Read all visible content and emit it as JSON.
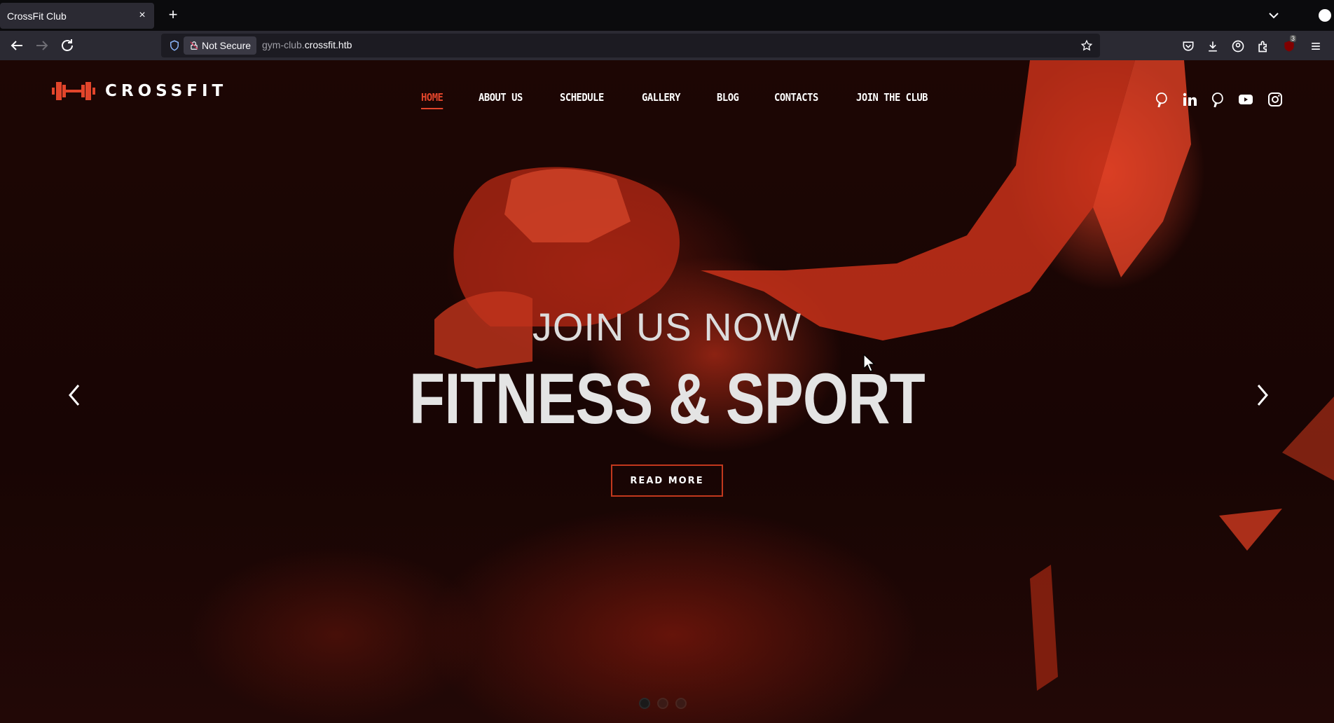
{
  "browser": {
    "tab_title": "CrossFit Club",
    "tab_close": "×",
    "new_tab": "+",
    "not_secure_label": "Not Secure",
    "url_prefix": "gym-club.",
    "url_host": "crossfit.htb",
    "extension_badge": "3"
  },
  "site": {
    "logo_text": "CROSSFIT",
    "accent_color": "#e2452b",
    "menu": [
      {
        "label": "HOME",
        "active": true
      },
      {
        "label": "ABOUT US",
        "active": false
      },
      {
        "label": "SCHEDULE",
        "active": false
      },
      {
        "label": "GALLERY",
        "active": false
      },
      {
        "label": "BLOG",
        "active": false
      },
      {
        "label": "CONTACTS",
        "active": false
      },
      {
        "label": "JOIN THE CLUB",
        "active": false
      }
    ],
    "social_icons": [
      "pinterest-icon",
      "linkedin-icon",
      "pinterest-icon",
      "youtube-icon",
      "instagram-icon"
    ]
  },
  "hero": {
    "subtitle": "JOIN US NOW",
    "title": "FITNESS & SPORT",
    "button_label": "READ MORE",
    "slides_count": 3,
    "active_slide": 1
  }
}
